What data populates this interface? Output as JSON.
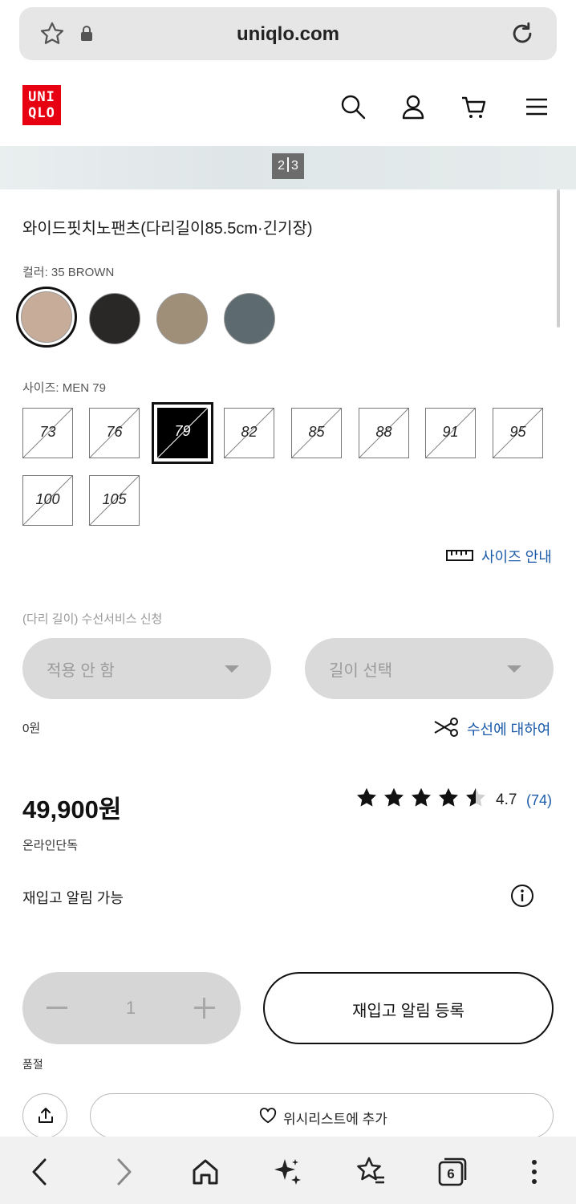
{
  "browser": {
    "url": "uniqlo.com",
    "star_icon": "star-outline-icon",
    "lock_icon": "lock-icon",
    "reload_icon": "reload-icon"
  },
  "header": {
    "logo_lines": [
      "UNI",
      "QLO"
    ],
    "brand_color": "#e60012",
    "icons": [
      "search-icon",
      "user-icon",
      "cart-icon",
      "menu-icon"
    ]
  },
  "gallery": {
    "pager_current": "2",
    "pager_total": "3"
  },
  "product": {
    "title": "와이드핏치노팬츠(다리길이85.5cm·긴기장)",
    "color_label": "컬러: 35 BROWN",
    "colors": [
      {
        "name": "BROWN",
        "hex": "#c7ad99",
        "selected": true
      },
      {
        "name": "BLACK",
        "hex": "#2a2727",
        "selected": false
      },
      {
        "name": "OLIVE",
        "hex": "#a08f78",
        "selected": false
      },
      {
        "name": "GRAY",
        "hex": "#5d6a6f",
        "selected": false
      }
    ],
    "size_label": "사이즈: MEN 79",
    "sizes": [
      {
        "label": "73",
        "selected": false
      },
      {
        "label": "76",
        "selected": false
      },
      {
        "label": "79",
        "selected": true
      },
      {
        "label": "82",
        "selected": false
      },
      {
        "label": "85",
        "selected": false
      },
      {
        "label": "88",
        "selected": false
      },
      {
        "label": "91",
        "selected": false
      },
      {
        "label": "95",
        "selected": false
      },
      {
        "label": "100",
        "selected": false
      },
      {
        "label": "105",
        "selected": false
      }
    ],
    "size_guide_label": "사이즈 안내",
    "alteration": {
      "label": "(다리 길이) 수선서비스 신청",
      "apply_select": "적용 안 함",
      "length_select": "길이 선택",
      "cost": "0원",
      "about_link": "수선에 대하여"
    },
    "price": "49,900원",
    "rating": {
      "value": "4.7",
      "count": "(74)",
      "stars": 4.7
    },
    "online_only": "온라인단독",
    "restock_available": "재입고 알림 가능",
    "quantity": "1",
    "restock_button": "재입고 알림 등록",
    "sold_out": "품절",
    "wishlist_button": "위시리스트에 추가"
  },
  "bottom_nav": {
    "icons": [
      "back-icon",
      "forward-icon",
      "home-icon",
      "sparkle-icon",
      "bookmark-star-icon",
      "tabs-icon",
      "more-icon"
    ],
    "tab_count": "6"
  }
}
